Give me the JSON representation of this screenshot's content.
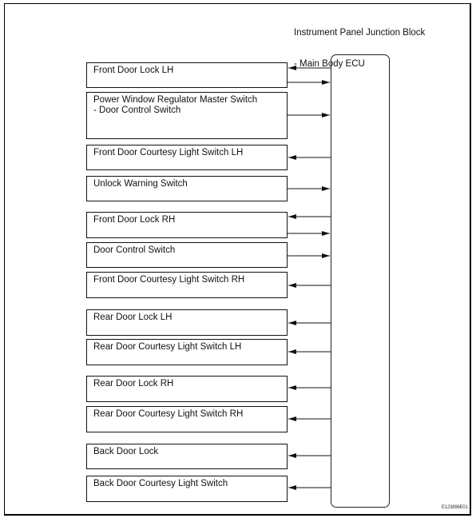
{
  "diagram": {
    "ecu": {
      "label_line1": "Instrument Panel Junction Block",
      "label_line2": "- Main Body ECU"
    },
    "components": [
      {
        "label": "Front Door Lock LH",
        "signals": [
          "from_ecu",
          "to_ecu"
        ]
      },
      {
        "label": "Power Window Regulator Master Switch\n- Door Control Switch",
        "signals": [
          "to_ecu"
        ]
      },
      {
        "label": "Front Door Courtesy Light Switch LH",
        "signals": [
          "from_ecu"
        ]
      },
      {
        "label": "Unlock Warning Switch",
        "signals": [
          "to_ecu"
        ]
      },
      {
        "label": "Front Door Lock RH",
        "signals": [
          "from_ecu",
          "to_ecu"
        ]
      },
      {
        "label": "Door Control Switch",
        "signals": [
          "to_ecu"
        ]
      },
      {
        "label": "Front Door Courtesy Light Switch RH",
        "signals": [
          "from_ecu"
        ]
      },
      {
        "label": "Rear Door Lock LH",
        "signals": [
          "from_ecu"
        ]
      },
      {
        "label": "Rear Door Courtesy Light Switch LH",
        "signals": [
          "from_ecu"
        ]
      },
      {
        "label": "Rear Door Lock RH",
        "signals": [
          "from_ecu"
        ]
      },
      {
        "label": "Rear Door Courtesy Light Switch RH",
        "signals": [
          "from_ecu"
        ]
      },
      {
        "label": "Back Door Lock",
        "signals": [
          "from_ecu"
        ]
      },
      {
        "label": "Back Door Courtesy Light Switch",
        "signals": [
          "from_ecu"
        ]
      }
    ],
    "figure_id": "E123896E01"
  }
}
